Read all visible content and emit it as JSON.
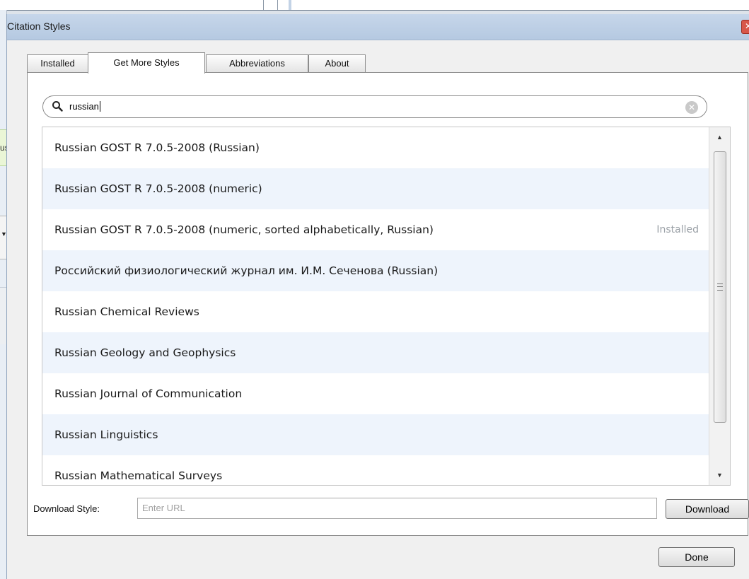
{
  "background": {
    "partial_text": "us"
  },
  "dialog": {
    "title": "Citation Styles",
    "close_glyph": "✕",
    "tabs": [
      {
        "label": "Installed"
      },
      {
        "label": "Get More Styles"
      },
      {
        "label": "Abbreviations"
      },
      {
        "label": "About"
      }
    ],
    "active_tab": "Get More Styles",
    "search": {
      "value": "russian",
      "clear_glyph": "✕"
    },
    "styles": [
      {
        "name": "Russian GOST R 7.0.5-2008 (Russian)",
        "status": ""
      },
      {
        "name": "Russian GOST R 7.0.5-2008 (numeric)",
        "status": ""
      },
      {
        "name": "Russian GOST R 7.0.5-2008 (numeric, sorted alphabetically, Russian)",
        "status": "Installed"
      },
      {
        "name": "Российский физиологический журнал им. И.М. Сеченова (Russian)",
        "status": ""
      },
      {
        "name": "Russian Chemical Reviews",
        "status": ""
      },
      {
        "name": "Russian Geology and Geophysics",
        "status": ""
      },
      {
        "name": "Russian Journal of Communication",
        "status": ""
      },
      {
        "name": "Russian Linguistics",
        "status": ""
      },
      {
        "name": "Russian Mathematical Surveys",
        "status": ""
      }
    ],
    "download": {
      "label": "Download Style:",
      "placeholder": "Enter URL",
      "button": "Download"
    },
    "done_button": "Done"
  }
}
